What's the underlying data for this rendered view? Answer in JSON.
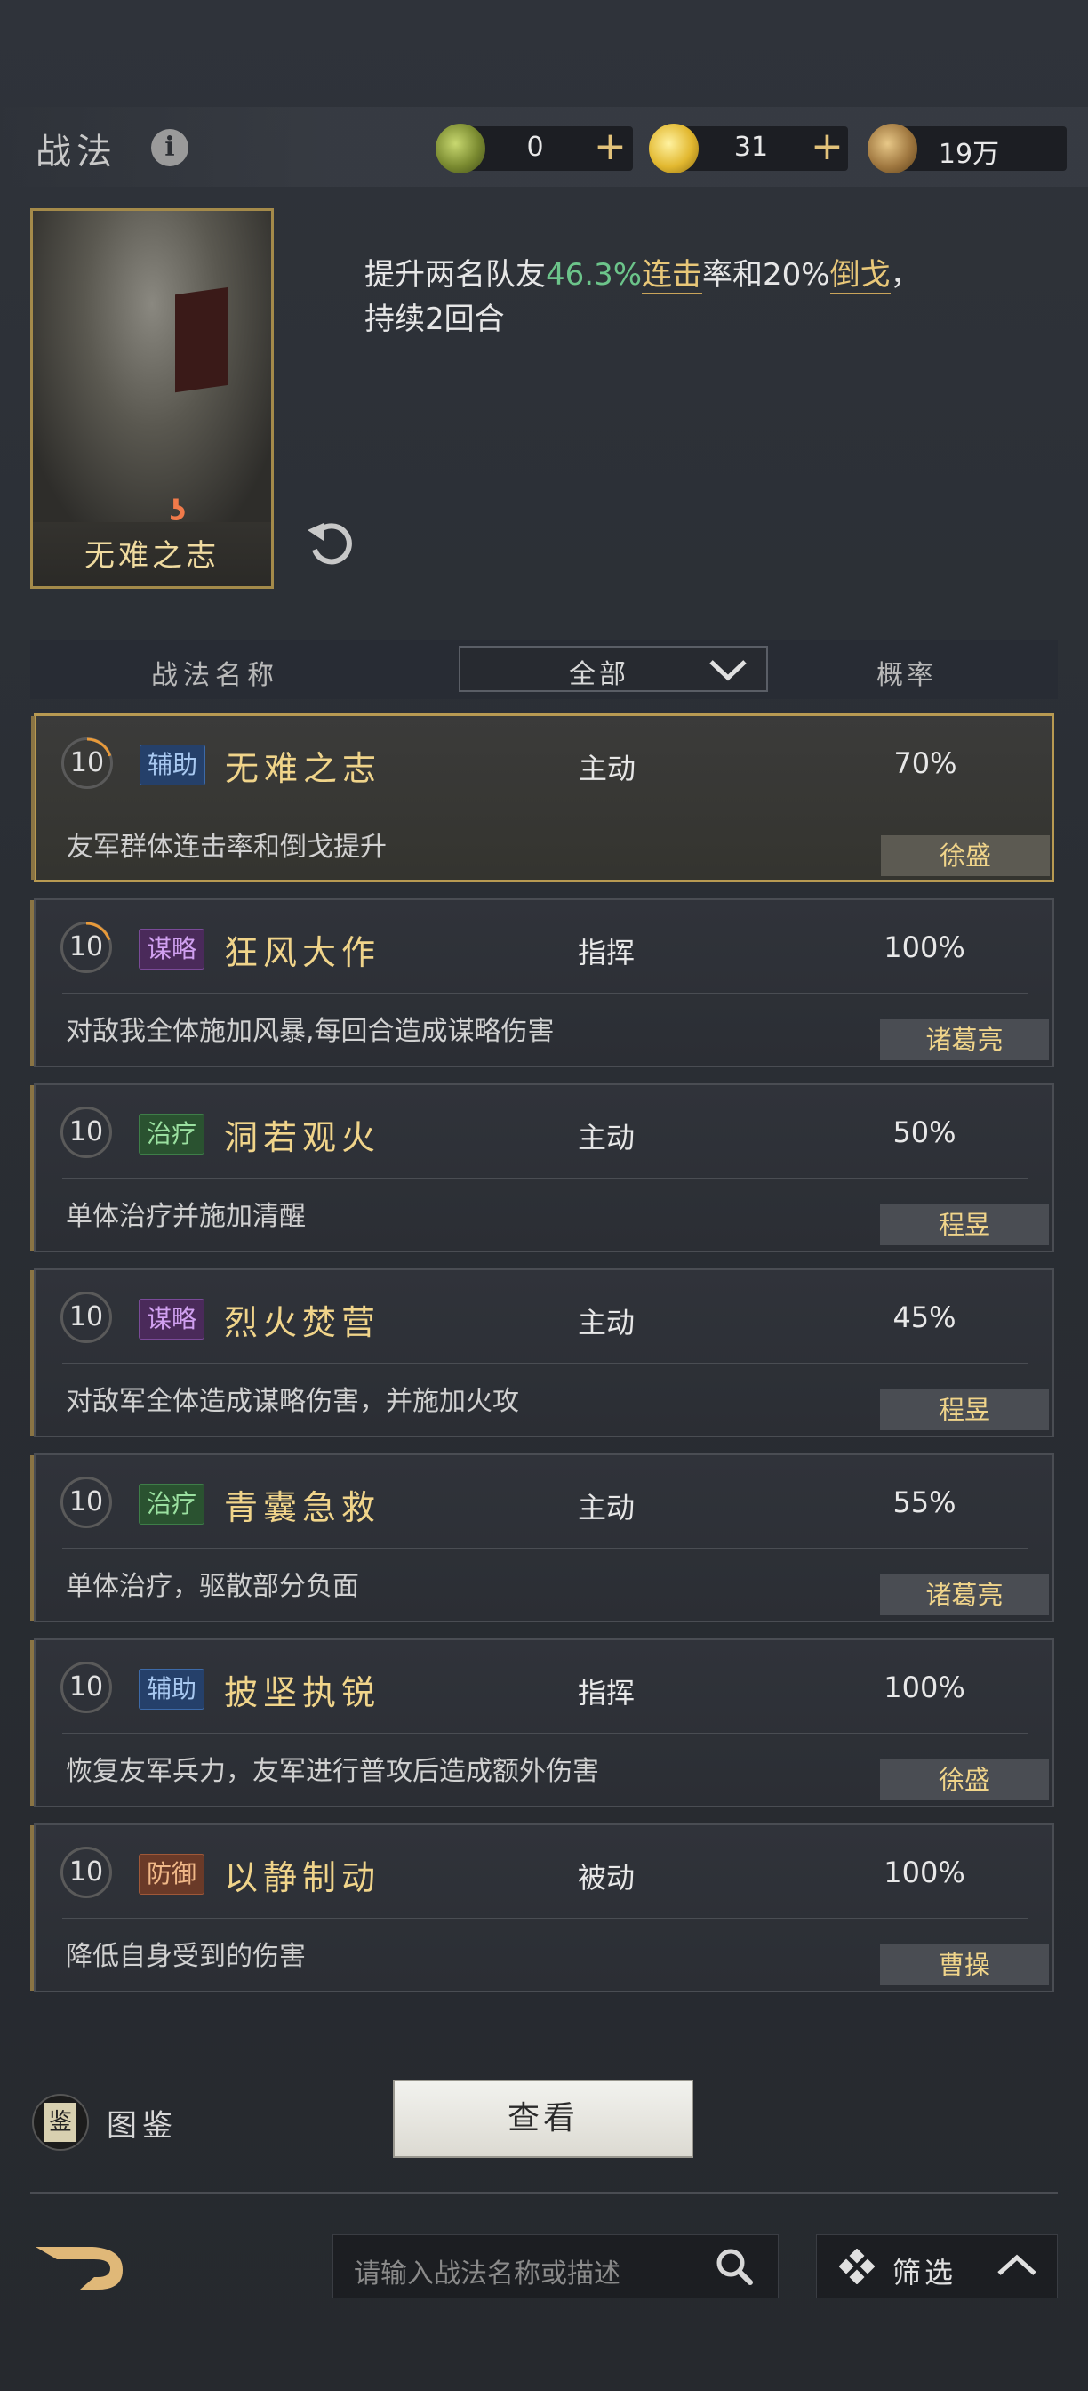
{
  "header": {
    "title": "战法",
    "info_icon": "i"
  },
  "resources": [
    {
      "icon": "jade-coin-icon",
      "value": "0",
      "plus": "+"
    },
    {
      "icon": "gold-coin-icon",
      "value": "31",
      "plus": "+"
    },
    {
      "icon": "copper-coin-icon",
      "value": "19万"
    }
  ],
  "selected_card": {
    "name": "无难之志",
    "description_parts": {
      "p1": "提升两名队友",
      "v1": "46.3%",
      "k1": "连击",
      "p2": "率和20%",
      "k2": "倒戈",
      "p3": "，",
      "line2": "持续2回合"
    }
  },
  "table_header": {
    "name": "战法名称",
    "filter": "全部",
    "rate": "概率"
  },
  "skills": [
    {
      "level": "10",
      "tag": "辅助",
      "tag_type": "aux",
      "name": "无难之志",
      "type": "主动",
      "rate": "70%",
      "desc": "友军群体连击率和倒戈提升",
      "hero": "徐盛",
      "selected": true,
      "progress": 0.2
    },
    {
      "level": "10",
      "tag": "谋略",
      "tag_type": "str",
      "name": "狂风大作",
      "type": "指挥",
      "rate": "100%",
      "desc": "对敌我全体施加风暴,每回合造成谋略伤害",
      "hero": "诸葛亮",
      "selected": false,
      "progress": 0.2
    },
    {
      "level": "10",
      "tag": "治疗",
      "tag_type": "heal",
      "name": "洞若观火",
      "type": "主动",
      "rate": "50%",
      "desc": "单体治疗并施加清醒",
      "hero": "程昱",
      "selected": false,
      "progress": 0
    },
    {
      "level": "10",
      "tag": "谋略",
      "tag_type": "str",
      "name": "烈火焚营",
      "type": "主动",
      "rate": "45%",
      "desc": "对敌军全体造成谋略伤害，并施加火攻",
      "hero": "程昱",
      "selected": false,
      "progress": 0
    },
    {
      "level": "10",
      "tag": "治疗",
      "tag_type": "heal",
      "name": "青囊急救",
      "type": "主动",
      "rate": "55%",
      "desc": "单体治疗，驱散部分负面",
      "hero": "诸葛亮",
      "selected": false,
      "progress": 0
    },
    {
      "level": "10",
      "tag": "辅助",
      "tag_type": "aux",
      "name": "披坚执锐",
      "type": "指挥",
      "rate": "100%",
      "desc": "恢复友军兵力，友军进行普攻后造成额外伤害",
      "hero": "徐盛",
      "selected": false,
      "progress": 0
    },
    {
      "level": "10",
      "tag": "防御",
      "tag_type": "def",
      "name": "以静制动",
      "type": "被动",
      "rate": "100%",
      "desc": "降低自身受到的伤害",
      "hero": "曹操",
      "selected": false,
      "progress": 0
    }
  ],
  "bottom": {
    "codex_glyph": "鉴",
    "codex_label": "图鉴",
    "view_button": "查看",
    "search_placeholder": "请输入战法名称或描述",
    "filter_label": "筛选"
  }
}
